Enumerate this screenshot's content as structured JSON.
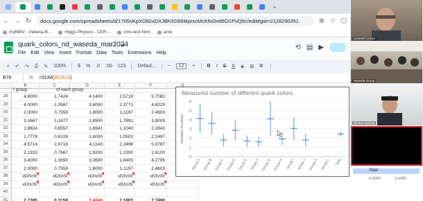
{
  "browser": {
    "url": "docs.google.com/spreadsheets/d/1705sKpXO82xDXJBhXDlI6MprxcMcKfoOxtt8O1PvQ5c/edit#gid=2128290351",
    "bookmarks": [
      "myBMV - Indiana B...",
      "Higgs Physics - CER...",
      "cms-test.html",
      "ame"
    ]
  },
  "sheets": {
    "title": "quark_colors_nd_waseda_mar2024",
    "menu": [
      "File",
      "Edit",
      "View",
      "Insert",
      "Format",
      "Data",
      "Tools",
      "Extensions",
      "Help"
    ],
    "toolbar": {
      "zoom": "100%",
      "currency": "$",
      "percent": "%",
      "dec_less": ".0",
      "dec_more": ".00",
      "num_format": "123",
      "font": "Defaul...",
      "font_size": "12"
    },
    "namebox": "B76",
    "formula_prefix": "=SUM(",
    "formula_ref": "B3:B14",
    "formula_suffix": ")"
  },
  "grid": {
    "columns": [
      "B",
      "C",
      "D",
      "E",
      "F",
      "G"
    ],
    "header_row": {
      "label": "",
      "cells": [
        "f group",
        "",
        "of each group",
        "",
        "",
        ""
      ]
    },
    "rows": [
      {
        "num": "28",
        "cells": [
          "4,6000",
          "1,7424",
          "4,1400",
          "2,5718",
          "5,7082"
        ]
      },
      {
        "num": "29",
        "cells": [
          "4,0000",
          "1,3587",
          "3,6000",
          "2,3771",
          "4,8229"
        ]
      },
      {
        "num": "30",
        "cells": [
          "2,0000",
          "0,7559",
          "1,8000",
          "1,1197",
          "2,4803"
        ]
      },
      {
        "num": "31",
        "cells": [
          "3,1667",
          "1,1677",
          "2,8500",
          "1,7891",
          "3,9009"
        ]
      },
      {
        "num": "32",
        "cells": [
          "1,8824",
          "0,6557",
          "1,6941",
          "1,1040",
          "2,2842"
        ]
      },
      {
        "num": "33",
        "cells": [
          "1,7778",
          "0,6108",
          "1,6000",
          "1,0503",
          "2,1497"
        ]
      },
      {
        "num": "34",
        "cells": [
          "4,5714",
          "2,0716",
          "4,1143",
          "2,2498",
          "5,9787"
        ]
      },
      {
        "num": "35",
        "cells": [
          "2,1333",
          "0,7667",
          "1,9200",
          "1,2300",
          "2,6100"
        ]
      },
      {
        "num": "36",
        "cells": [
          "3,4000",
          "1,3550",
          "3,0600",
          "1,8405",
          "4,2795"
        ]
      },
      {
        "num": "37",
        "cells": [
          "2,0000",
          "0,7559",
          "1,8000",
          "1,1197",
          "2,4803"
        ]
      },
      {
        "num": "38",
        "cells": [
          "#DIV/0!",
          "#DIV/0!",
          "#DIV/0!",
          "#DIV/0!",
          "#DIV/0!"
        ],
        "error": true
      },
      {
        "num": "39",
        "cells": [
          "#DIV/0!",
          "#DIV/0!",
          "#DIV/0!",
          "#DIV/0!",
          "#DIV/0!"
        ],
        "error": true
      },
      {
        "num": "40",
        "cells": [
          "",
          "",
          "",
          "",
          ""
        ]
      },
      {
        "num": "41",
        "cells": [
          "2,7385",
          "0,3159",
          "2,4646",
          "2,1803",
          "2,7490"
        ],
        "total": true
      }
    ]
  },
  "chart_data": {
    "type": "scatter",
    "title": "Measured number of different quark colors",
    "xlabel": "",
    "ylabel": "Number of colors",
    "categories": [
      "Group A",
      "Group B",
      "Group C",
      "Group D",
      "Group E",
      "Group F",
      "Group G",
      "Group H",
      "Group I",
      "Group J",
      "Group K",
      "Group L",
      "Total"
    ],
    "values": [
      4.14,
      3.6,
      1.8,
      2.85,
      1.69,
      1.6,
      4.11,
      1.92,
      3.06,
      1.8,
      null,
      null,
      2.46
    ],
    "errors": [
      1.57,
      1.22,
      0.68,
      1.05,
      0.59,
      0.55,
      1.86,
      0.69,
      1.22,
      0.68,
      null,
      null,
      0.28
    ],
    "ylim": [
      0,
      6
    ],
    "yticks": [
      "0",
      "1",
      "2",
      "3",
      "4",
      "5",
      "6"
    ],
    "grid": true,
    "color": "#4a86c8"
  },
  "video": {
    "participants": [
      "Kenneth Cecire",
      "Waseda Group",
      "Shohei Nishida",
      ""
    ]
  },
  "total_chart": {
    "label": "Total",
    "ticks": [
      "0,0000",
      "1,0000"
    ]
  }
}
